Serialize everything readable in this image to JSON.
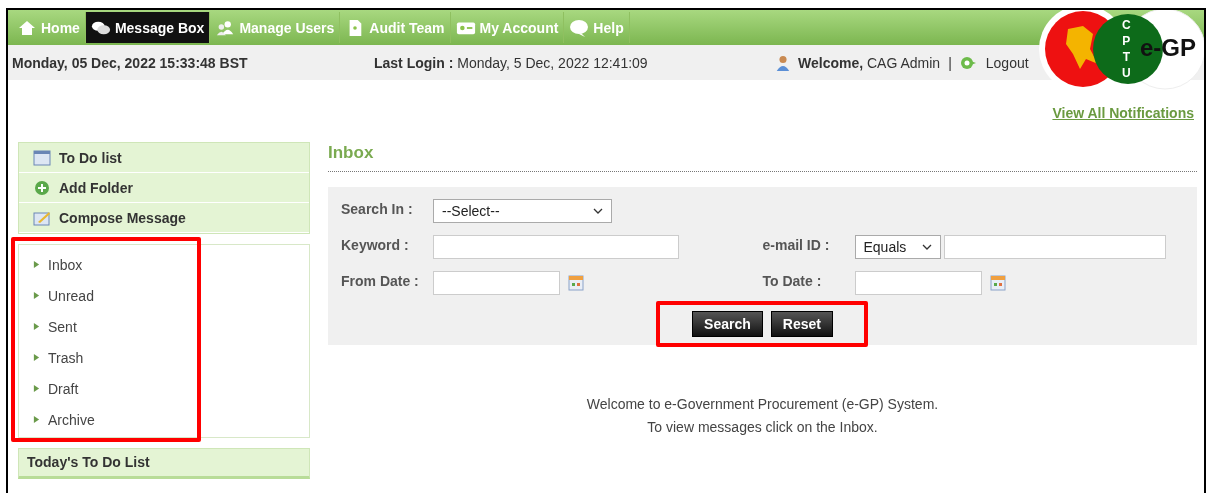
{
  "nav": [
    {
      "label": "Home",
      "kind": "home",
      "selected": false
    },
    {
      "label": "Message Box",
      "kind": "messages",
      "selected": true
    },
    {
      "label": "Manage Users",
      "kind": "users",
      "selected": false
    },
    {
      "label": "Audit Team",
      "kind": "audit",
      "selected": false
    },
    {
      "label": "My Account",
      "kind": "account",
      "selected": false
    },
    {
      "label": "Help",
      "kind": "help",
      "selected": false
    }
  ],
  "info_bar": {
    "date": "Monday, 05 Dec, 2022 15:33:48 BST",
    "last_login_label": "Last Login :",
    "last_login_value": "Monday, 5 Dec, 2022 12:41:09",
    "welcome_label": "Welcome,",
    "user_name": "CAG Admin",
    "separator": "|",
    "logout": "Logout"
  },
  "logo": {
    "letters": [
      "C",
      "P",
      "T",
      "U"
    ],
    "name": "e-GP"
  },
  "notifications_link": "View All Notifications",
  "sidebar": {
    "actions": [
      {
        "label": "To Do list",
        "kind": "list"
      },
      {
        "label": "Add Folder",
        "kind": "add"
      },
      {
        "label": "Compose Message",
        "kind": "compose"
      }
    ],
    "folders": [
      "Inbox",
      "Unread",
      "Sent",
      "Trash",
      "Draft",
      "Archive"
    ],
    "folders_highlighted": true,
    "todays_heading": "Today's To Do List"
  },
  "content": {
    "title": "Inbox",
    "search_in": {
      "label": "Search In :",
      "value": "--Select--"
    },
    "keyword": {
      "label": "Keyword :"
    },
    "email": {
      "label": "e-mail ID :",
      "operator": "Equals"
    },
    "from_date": {
      "label": "From Date :"
    },
    "to_date": {
      "label": "To Date :"
    },
    "buttons": [
      "Search",
      "Reset"
    ],
    "buttons_highlighted": true,
    "message": [
      "Welcome to e-Government Procurement (e-GP) System.",
      "To view messages click on the Inbox."
    ]
  }
}
